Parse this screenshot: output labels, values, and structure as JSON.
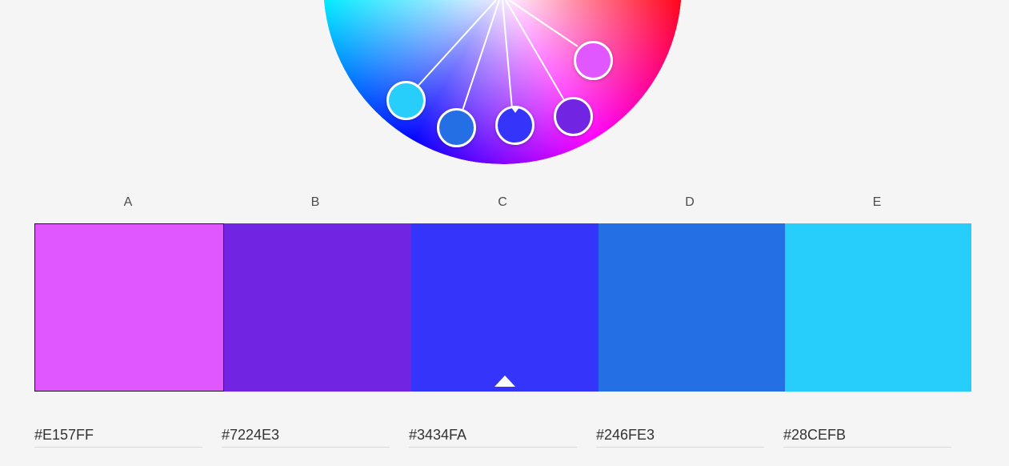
{
  "wheel": {
    "handles": [
      {
        "name": "color-handle-e",
        "color": "#28CEFB",
        "base": false
      },
      {
        "name": "color-handle-d",
        "color": "#246FE3",
        "base": false
      },
      {
        "name": "color-handle-c",
        "color": "#3434FA",
        "base": true
      },
      {
        "name": "color-handle-b",
        "color": "#7224E3",
        "base": false
      },
      {
        "name": "color-handle-a",
        "color": "#E157FF",
        "base": false
      }
    ]
  },
  "swatches": [
    {
      "letter": "A",
      "color": "#E157FF",
      "hex": "#E157FF",
      "selected": true,
      "base": false
    },
    {
      "letter": "B",
      "color": "#7224E3",
      "hex": "#7224E3",
      "selected": false,
      "base": false
    },
    {
      "letter": "C",
      "color": "#3434FA",
      "hex": "#3434FA",
      "selected": false,
      "base": true
    },
    {
      "letter": "D",
      "color": "#246FE3",
      "hex": "#246FE3",
      "selected": false,
      "base": false
    },
    {
      "letter": "E",
      "color": "#28CEFB",
      "hex": "#28CEFB",
      "selected": false,
      "base": false
    }
  ]
}
